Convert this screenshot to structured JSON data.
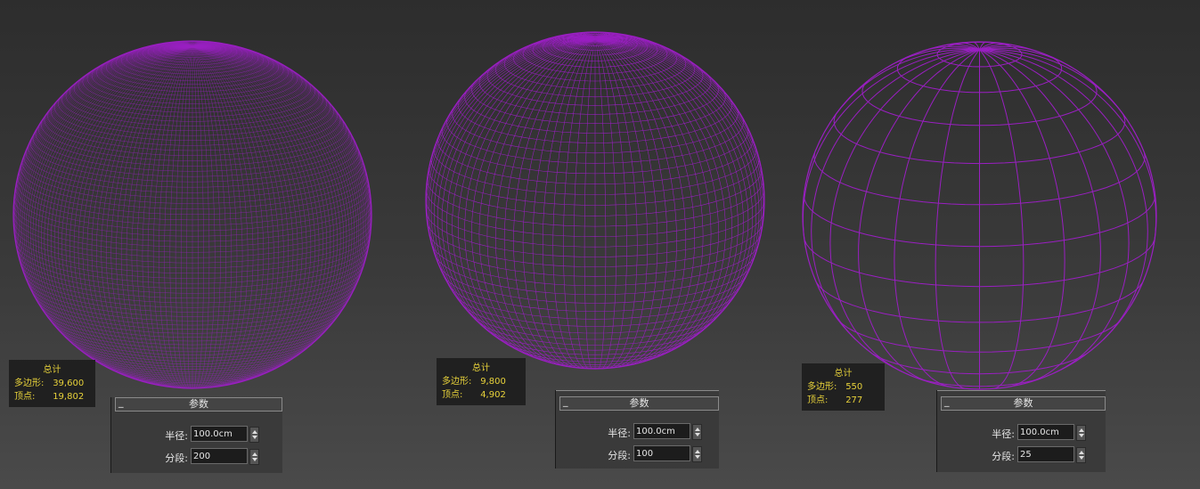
{
  "color": {
    "wire": "#9a1fc2",
    "stats_text": "#e8d23a"
  },
  "viewports": [
    {
      "stats": {
        "title": "总计",
        "polys_label": "多边形:",
        "polys": "39,600",
        "verts_label": "顶点:",
        "verts": "19,802"
      },
      "panel": {
        "title": "参数",
        "minus": "_",
        "radius_label": "半径:",
        "radius": "100.0cm",
        "segments_label": "分段:",
        "segments": "200"
      }
    },
    {
      "stats": {
        "title": "总计",
        "polys_label": "多边形:",
        "polys": "9,800",
        "verts_label": "顶点:",
        "verts": "4,902"
      },
      "panel": {
        "title": "参数",
        "minus": "_",
        "radius_label": "半径:",
        "radius": "100.0cm",
        "segments_label": "分段:",
        "segments": "100"
      }
    },
    {
      "stats": {
        "title": "总计",
        "polys_label": "多边形:",
        "polys": "550",
        "verts_label": "顶点:",
        "verts": "277"
      },
      "panel": {
        "title": "参数",
        "minus": "_",
        "radius_label": "半径:",
        "radius": "100.0cm",
        "segments_label": "分段:",
        "segments": "25"
      }
    }
  ]
}
